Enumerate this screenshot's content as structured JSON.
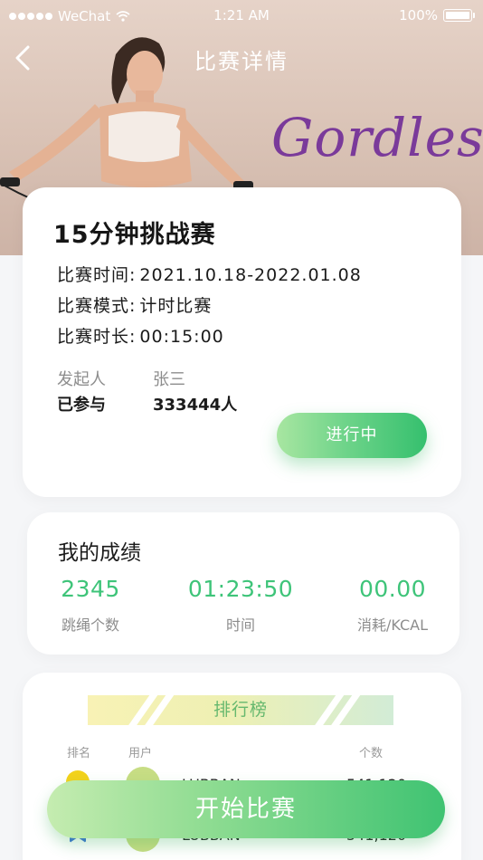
{
  "status_bar": {
    "carrier": "WeChat",
    "time": "1:21 AM",
    "battery": "100%"
  },
  "nav": {
    "title": "比赛详情"
  },
  "hero": {
    "brand_text": "Gordless"
  },
  "challenge": {
    "title": "15分钟挑战赛",
    "rows": [
      {
        "label": "比赛时间:",
        "value": "2021.10.18-2022.01.08"
      },
      {
        "label": "比赛模式:",
        "value": "计时比赛"
      },
      {
        "label": "比赛时长:",
        "value": "00:15:00"
      }
    ],
    "initiator_label": "发起人",
    "initiator_value": "张三",
    "joined_label": "已参与",
    "joined_value": "333444人",
    "status": "进行中"
  },
  "my_score": {
    "title": "我的成绩",
    "stats": [
      {
        "value": "2345",
        "label": "跳绳个数"
      },
      {
        "value": "01:23:50",
        "label": "时间"
      },
      {
        "value": "00.00",
        "label": "消耗/KCAL"
      }
    ]
  },
  "ranking": {
    "title": "排行榜",
    "columns": {
      "rank": "排名",
      "user": "用户",
      "count": "个数"
    },
    "rows": [
      {
        "name": "LUBBAN",
        "count": "541,120"
      },
      {
        "name": "LUBBAN",
        "count": "541,120"
      }
    ]
  },
  "start_button": "开始比赛"
}
